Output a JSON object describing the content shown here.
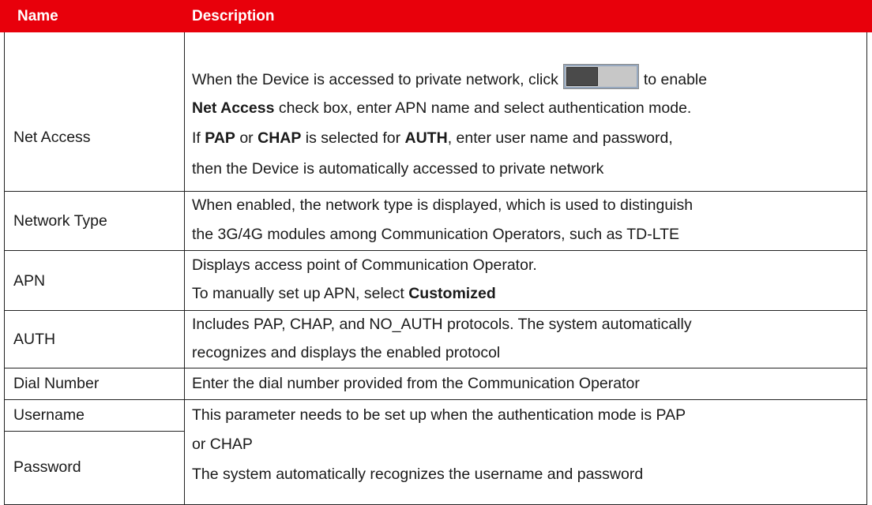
{
  "header": {
    "name": "Name",
    "description": "Description"
  },
  "rows": [
    {
      "name": "Net Access",
      "line1_before": "When the Device is accessed to private network, click",
      "line1_after": "to enable",
      "line2_bold": "Net Access",
      "line2_rest": " check box, enter APN name and select authentication mode.",
      "line3_a": "If ",
      "line3_pap": "PAP",
      "line3_b": " or ",
      "line3_chap": "CHAP",
      "line3_c": " is selected for ",
      "line3_auth": "AUTH",
      "line3_d": ", enter user name and password,",
      "line4": "then the Device is automatically accessed to private network",
      "toggle_icon": "toggle-switch-icon"
    },
    {
      "name": "Network Type",
      "line1": "When enabled, the network type is displayed, which is used to distinguish",
      "line2": "the 3G/4G modules among Communication Operators, such as TD-LTE"
    },
    {
      "name": "APN",
      "line1": "Displays access point of Communication Operator.",
      "line2_before": "To manually set up APN, select ",
      "line2_bold": "Customized"
    },
    {
      "name": "AUTH",
      "line1": "Includes PAP, CHAP, and NO_AUTH protocols. The system automatically",
      "line2": "recognizes and displays the enabled protocol"
    },
    {
      "name": "Dial Number",
      "line1": "Enter the dial number provided from the Communication Operator"
    },
    {
      "name_a": "Username",
      "name_b": "Password",
      "line1": "This parameter needs to be set up when the authentication mode is PAP",
      "line2": "or CHAP",
      "line3": "The system automatically recognizes the username and password"
    }
  ],
  "colors": {
    "header_bg": "#e8000b",
    "header_text": "#ffffff",
    "rule": "#222222"
  }
}
